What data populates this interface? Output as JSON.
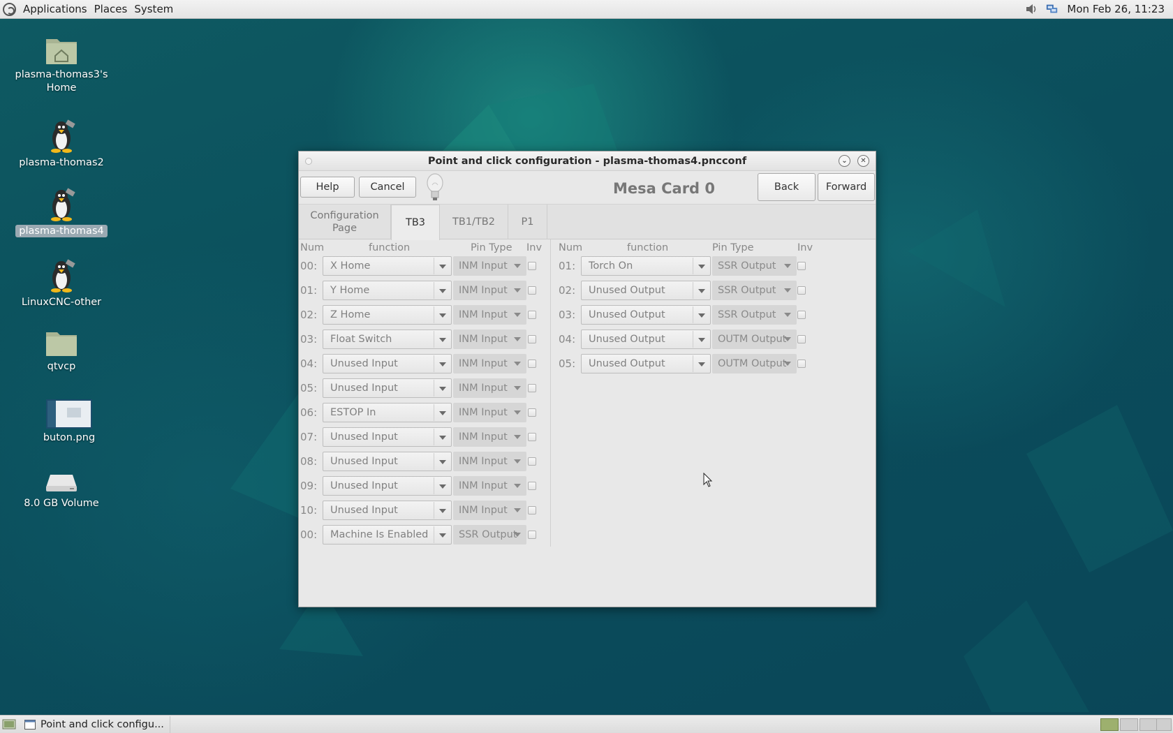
{
  "top_panel": {
    "menus": [
      "Applications",
      "Places",
      "System"
    ],
    "clock": "Mon Feb 26, 11:23"
  },
  "desktop_icons": [
    {
      "label": "plasma-thomas3's Home",
      "icon": "home-folder-icon"
    },
    {
      "label": "plasma-thomas2",
      "icon": "penguin-launcher-icon"
    },
    {
      "label": "plasma-thomas4",
      "icon": "penguin-launcher-icon"
    },
    {
      "label": "LinuxCNC-other",
      "icon": "penguin-launcher-icon"
    },
    {
      "label": "qtvcp",
      "icon": "folder-icon"
    },
    {
      "label": "buton.png",
      "icon": "image-file-icon"
    },
    {
      "label": "8.0 GB Volume",
      "icon": "drive-icon"
    }
  ],
  "window": {
    "title": "Point and click configuration - plasma-thomas4.pncconf",
    "toolbar": {
      "help": "Help",
      "cancel": "Cancel",
      "heading": "Mesa Card 0",
      "back": "Back",
      "forward": "Forward"
    },
    "tabs": [
      {
        "label": "Configuration\nPage",
        "active": false
      },
      {
        "label": "TB3",
        "active": true
      },
      {
        "label": "TB1/TB2",
        "active": false
      },
      {
        "label": "P1",
        "active": false
      }
    ],
    "left_headers": {
      "num": "Num",
      "function": "function",
      "pin_type": "Pin Type",
      "inv": "Inv"
    },
    "right_headers": {
      "num": "Num",
      "function": "function",
      "pin_type": "Pin Type",
      "inv": "Inv"
    },
    "left_rows": [
      {
        "num": "00:",
        "function": "X Home",
        "pin_type": "INM Input",
        "inv": false
      },
      {
        "num": "01:",
        "function": "Y Home",
        "pin_type": "INM Input",
        "inv": false
      },
      {
        "num": "02:",
        "function": "Z Home",
        "pin_type": "INM Input",
        "inv": false
      },
      {
        "num": "03:",
        "function": "Float Switch",
        "pin_type": "INM Input",
        "inv": false
      },
      {
        "num": "04:",
        "function": "Unused Input",
        "pin_type": "INM Input",
        "inv": false
      },
      {
        "num": "05:",
        "function": "Unused Input",
        "pin_type": "INM Input",
        "inv": false
      },
      {
        "num": "06:",
        "function": "ESTOP In",
        "pin_type": "INM Input",
        "inv": false
      },
      {
        "num": "07:",
        "function": "Unused Input",
        "pin_type": "INM Input",
        "inv": false
      },
      {
        "num": "08:",
        "function": "Unused Input",
        "pin_type": "INM Input",
        "inv": false
      },
      {
        "num": "09:",
        "function": "Unused Input",
        "pin_type": "INM Input",
        "inv": false
      },
      {
        "num": "10:",
        "function": "Unused Input",
        "pin_type": "INM Input",
        "inv": false
      },
      {
        "num": "00:",
        "function": "Machine Is Enabled",
        "pin_type": "SSR Output",
        "inv": false
      }
    ],
    "right_rows": [
      {
        "num": "01:",
        "function": "Torch On",
        "pin_type": "SSR Output",
        "inv": false
      },
      {
        "num": "02:",
        "function": "Unused Output",
        "pin_type": "SSR Output",
        "inv": false
      },
      {
        "num": "03:",
        "function": "Unused Output",
        "pin_type": "SSR Output",
        "inv": false
      },
      {
        "num": "04:",
        "function": "Unused Output",
        "pin_type": "OUTM Output",
        "inv": false
      },
      {
        "num": "05:",
        "function": "Unused Output",
        "pin_type": "OUTM Output",
        "inv": false
      }
    ]
  },
  "taskbar": {
    "task_label": "Point and click configu..."
  }
}
